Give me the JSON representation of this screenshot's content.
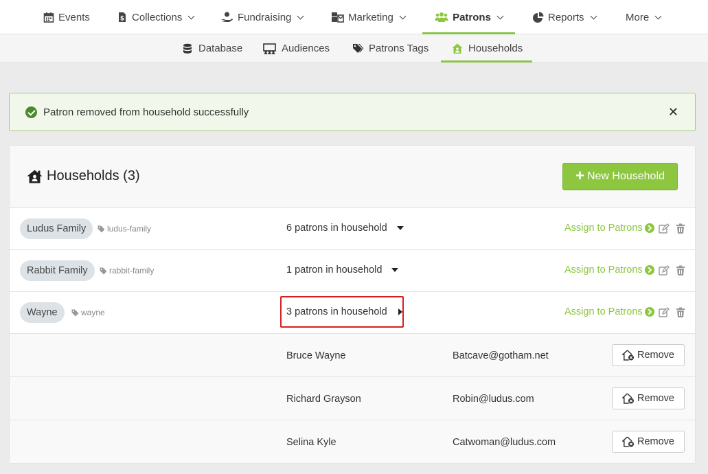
{
  "topnav": {
    "items": [
      {
        "label": "Events",
        "icon": "calendar-icon"
      },
      {
        "label": "Collections",
        "icon": "dollar-doc-icon"
      },
      {
        "label": "Fundraising",
        "icon": "donate-hand-icon"
      },
      {
        "label": "Marketing",
        "icon": "mail-bulk-icon"
      },
      {
        "label": "Patrons",
        "icon": "users-icon",
        "active": true
      },
      {
        "label": "Reports",
        "icon": "pie-chart-icon"
      },
      {
        "label": "More"
      }
    ]
  },
  "subnav": {
    "items": [
      {
        "label": "Database",
        "icon": "database-icon"
      },
      {
        "label": "Audiences",
        "icon": "audience-icon"
      },
      {
        "label": "Patrons Tags",
        "icon": "tags-icon"
      },
      {
        "label": "Households",
        "icon": "house-user-icon",
        "active": true
      }
    ]
  },
  "alert": {
    "message": "Patron removed from household successfully",
    "close": "✕"
  },
  "card": {
    "title": "Households (3)",
    "new_button": "New Household",
    "assign_label": "Assign to Patrons",
    "remove_label": "Remove",
    "households": [
      {
        "name": "Ludus Family",
        "slug": "ludus-family",
        "count": "6 patrons in household",
        "expanded": false
      },
      {
        "name": "Rabbit Family",
        "slug": "rabbit-family",
        "count": "1 patron in household",
        "expanded": false
      },
      {
        "name": "Wayne",
        "slug": "wayne",
        "count": "3 patrons in household",
        "expanded": true
      }
    ],
    "patrons": [
      {
        "name": "Bruce Wayne",
        "email": "Batcave@gotham.net"
      },
      {
        "name": "Richard Grayson",
        "email": "Robin@ludus.com"
      },
      {
        "name": "Selina Kyle",
        "email": "Catwoman@ludus.com"
      }
    ]
  },
  "colors": {
    "accent": "#8dc63f",
    "alert_bg": "#f1f7ea",
    "highlight": "#d32020"
  }
}
